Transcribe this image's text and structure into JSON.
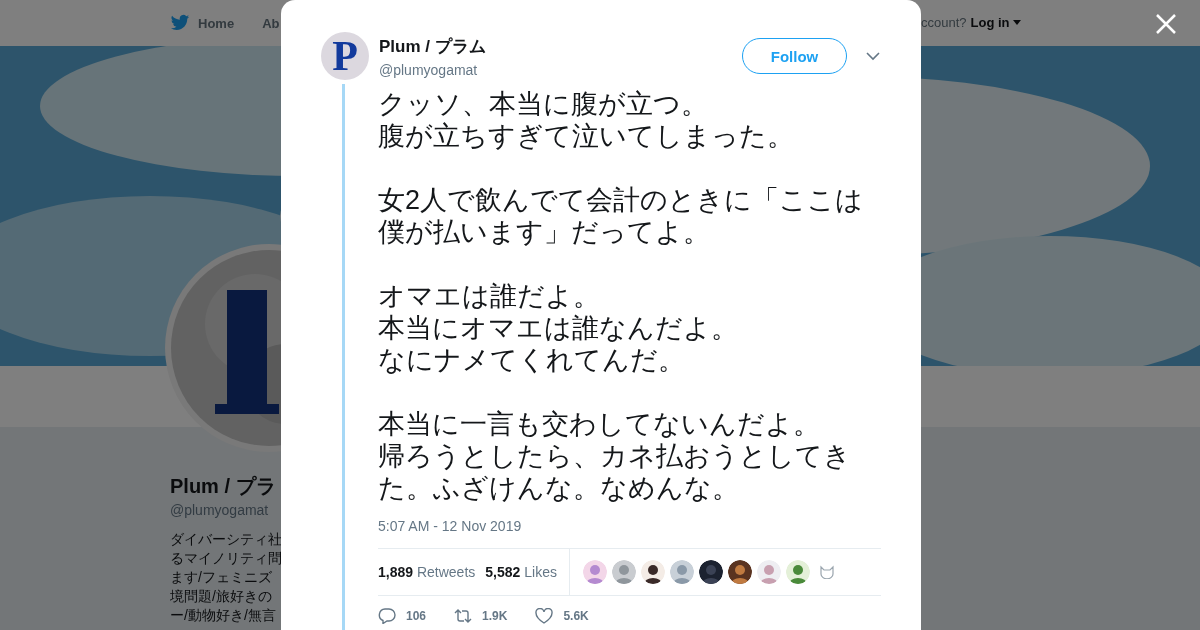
{
  "background_page": {
    "nav": [
      {
        "label": "Home",
        "kind": "home"
      },
      {
        "label": "Ab",
        "kind": "plain"
      }
    ],
    "account_prompt": "ccount?",
    "login": "Log in",
    "profile": {
      "name": "Plum / プラ",
      "handle": "@plumyogamat",
      "bio_lines": [
        "ダイバーシティ社",
        "るマイノリティ問",
        "ます/フェミニズ",
        "境問題/旅好きの",
        "ー/動物好き/無言"
      ]
    }
  },
  "modal": {
    "author": {
      "avatar_letter": "P",
      "name": "Plum / プラム",
      "handle": "@plumyogamat"
    },
    "follow": "Follow",
    "paragraphs": [
      [
        "クッソ、本当に腹が立つ。",
        "腹が立ちすぎて泣いてしまった。"
      ],
      [
        "女2人で飲んでて会計のときに「ここは",
        "僕が払います」だってよ。"
      ],
      [
        "オマエは誰だよ。",
        "本当にオマエは誰なんだよ。",
        "なにナメてくれてんだ。"
      ],
      [
        "本当に一言も交わしてないんだよ。",
        "帰ろうとしたら、カネ払おうとしてき",
        "た。ふざけんな。なめんな。"
      ]
    ],
    "timestamp": "5:07 AM - 12 Nov 2019",
    "stats": [
      {
        "count": "1,889",
        "label": "Retweets"
      },
      {
        "count": "5,582",
        "label": "Likes"
      }
    ],
    "likers": [
      {
        "kind": "picture"
      },
      {
        "kind": "picture"
      },
      {
        "kind": "picture"
      },
      {
        "kind": "picture"
      },
      {
        "kind": "picture"
      },
      {
        "kind": "picture"
      },
      {
        "kind": "picture"
      },
      {
        "kind": "picture"
      },
      {
        "kind": "icon"
      }
    ],
    "actions": [
      {
        "kind": "reply",
        "count": "106"
      },
      {
        "kind": "retweet",
        "count": "1.9K"
      },
      {
        "kind": "like",
        "count": "5.6K"
      }
    ]
  }
}
